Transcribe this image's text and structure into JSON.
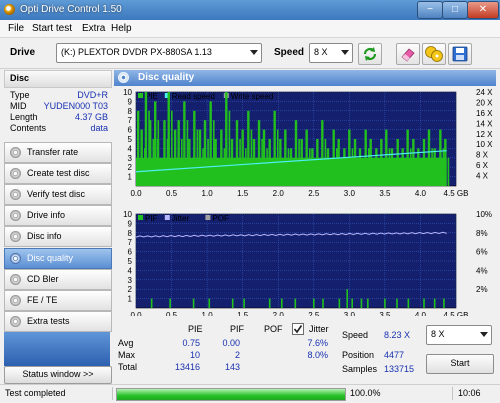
{
  "app": {
    "title": "Opti Drive Control 1.50"
  },
  "window_buttons": {
    "minimize": "−",
    "maximize": "□",
    "close": "✕"
  },
  "menu": [
    "File",
    "Start test",
    "Extra",
    "Help"
  ],
  "toolbar": {
    "drive_label": "Drive",
    "drive_value": "(K:)  PLEXTOR DVDR   PX-880SA 1.13",
    "speed_label": "Speed",
    "speed_value": "8 X",
    "icons": [
      "refresh-icon",
      "eraser-icon",
      "copy-disc-icon",
      "save-icon"
    ]
  },
  "disc": {
    "header": "Disc",
    "rows": [
      {
        "key": "Type",
        "value": "DVD+R"
      },
      {
        "key": "MID",
        "value": "YUDEN000 T03"
      },
      {
        "key": "Length",
        "value": "4.37 GB"
      },
      {
        "key": "Contents",
        "value": "data"
      }
    ]
  },
  "nav": [
    {
      "label": "Transfer rate",
      "active": false
    },
    {
      "label": "Create test disc",
      "active": false
    },
    {
      "label": "Verify test disc",
      "active": false
    },
    {
      "label": "Drive info",
      "active": false
    },
    {
      "label": "Disc info",
      "active": false
    },
    {
      "label": "Disc quality",
      "active": true
    },
    {
      "label": "CD Bler",
      "active": false
    },
    {
      "label": "FE / TE",
      "active": false
    },
    {
      "label": "Extra tests",
      "active": false
    }
  ],
  "status_window_button": "Status window >>",
  "panel": {
    "title": "Disc quality"
  },
  "colors": {
    "plot_bg": "#14206e",
    "grid": "#3a60c8",
    "pie": "#22c01e",
    "pif": "#22c01e",
    "read_speed": "#4cf0f0",
    "jitter": "#b8b8ff",
    "accent": "#4f83cc"
  },
  "chart_data": [
    {
      "type": "bar",
      "legend": [
        "PIE",
        "Read speed",
        "Write speed"
      ],
      "x_ticks": [
        "0.0",
        "0.5",
        "1.0",
        "1.5",
        "2.0",
        "2.5",
        "3.0",
        "3.5",
        "4.0",
        "4.5 GB"
      ],
      "y_left_ticks": [
        "1",
        "2",
        "3",
        "4",
        "5",
        "6",
        "7",
        "8",
        "9",
        "10"
      ],
      "y_right_ticks": [
        "4 X",
        "6 X",
        "8 X",
        "10 X",
        "12 X",
        "14 X",
        "16 X",
        "20 X",
        "24 X"
      ],
      "xlim": [
        0,
        4.5
      ],
      "ylim": [
        0,
        10
      ],
      "y2lim": [
        0,
        24
      ],
      "grid": true,
      "pie_bar_peaks": [
        [
          0.03,
          8
        ],
        [
          0.08,
          6
        ],
        [
          0.14,
          10
        ],
        [
          0.2,
          7
        ],
        [
          0.27,
          9
        ],
        [
          0.31,
          5
        ],
        [
          0.4,
          7
        ],
        [
          0.46,
          10
        ],
        [
          0.55,
          6
        ],
        [
          0.6,
          7
        ],
        [
          0.68,
          9
        ],
        [
          0.75,
          5
        ],
        [
          0.82,
          8
        ],
        [
          0.9,
          6
        ],
        [
          0.97,
          7
        ],
        [
          1.05,
          9
        ],
        [
          1.12,
          5
        ],
        [
          1.2,
          6
        ],
        [
          1.27,
          10
        ],
        [
          1.35,
          5
        ],
        [
          1.42,
          7
        ],
        [
          1.5,
          6
        ],
        [
          1.58,
          8
        ],
        [
          1.66,
          5
        ],
        [
          1.73,
          7
        ],
        [
          1.8,
          6
        ],
        [
          1.88,
          5
        ],
        [
          1.95,
          8
        ],
        [
          2.03,
          5
        ],
        [
          2.1,
          6
        ],
        [
          2.18,
          4
        ],
        [
          2.25,
          7
        ],
        [
          2.33,
          5
        ],
        [
          2.4,
          6
        ],
        [
          2.48,
          4
        ],
        [
          2.55,
          5
        ],
        [
          2.62,
          7
        ],
        [
          2.7,
          4
        ],
        [
          2.78,
          6
        ],
        [
          2.85,
          5
        ],
        [
          2.93,
          4
        ],
        [
          3.0,
          6
        ],
        [
          3.08,
          5
        ],
        [
          3.15,
          4
        ],
        [
          3.23,
          6
        ],
        [
          3.3,
          5
        ],
        [
          3.38,
          4
        ],
        [
          3.45,
          5
        ],
        [
          3.52,
          6
        ],
        [
          3.6,
          4
        ],
        [
          3.68,
          5
        ],
        [
          3.75,
          4
        ],
        [
          3.82,
          6
        ],
        [
          3.9,
          5
        ],
        [
          3.97,
          4
        ],
        [
          4.05,
          5
        ],
        [
          4.12,
          6
        ],
        [
          4.2,
          4
        ],
        [
          4.28,
          6
        ],
        [
          4.35,
          5
        ]
      ],
      "pie_baseline": 3,
      "read_speed": {
        "x": [
          0.0,
          4.37
        ],
        "y": [
          3.3,
          8.2
        ]
      }
    },
    {
      "type": "bar",
      "legend": [
        "PIF",
        "Jitter",
        "POF"
      ],
      "x_ticks": [
        "0.0",
        "0.5",
        "1.0",
        "1.5",
        "2.0",
        "2.5",
        "3.0",
        "3.5",
        "4.0",
        "4.5 GB"
      ],
      "y_left_ticks": [
        "1",
        "2",
        "3",
        "4",
        "5",
        "6",
        "7",
        "8",
        "9",
        "10"
      ],
      "y_right_ticks": [
        "2%",
        "4%",
        "6%",
        "8%",
        "10%"
      ],
      "xlim": [
        0,
        4.5
      ],
      "ylim": [
        0,
        10
      ],
      "y2lim": [
        0,
        10
      ],
      "grid": true,
      "pif_spikes": [
        [
          0.22,
          1
        ],
        [
          0.48,
          1
        ],
        [
          0.81,
          1
        ],
        [
          1.03,
          1
        ],
        [
          1.36,
          1
        ],
        [
          1.52,
          1
        ],
        [
          1.88,
          1
        ],
        [
          2.05,
          1
        ],
        [
          2.24,
          1
        ],
        [
          2.5,
          1
        ],
        [
          2.63,
          1
        ],
        [
          2.86,
          1
        ],
        [
          2.97,
          2
        ],
        [
          3.04,
          1
        ],
        [
          3.17,
          1
        ],
        [
          3.26,
          1
        ],
        [
          3.5,
          1
        ],
        [
          3.67,
          1
        ],
        [
          3.83,
          1
        ],
        [
          4.05,
          1
        ],
        [
          4.2,
          1
        ],
        [
          4.33,
          1
        ]
      ],
      "jitter": {
        "x": [
          0.0,
          4.37
        ],
        "y": [
          7.6,
          8.0
        ]
      }
    }
  ],
  "stats": {
    "headers": [
      "PIE",
      "PIF",
      "POF",
      "Jitter"
    ],
    "rows": [
      {
        "label": "Avg",
        "pie": "0.75",
        "pif": "0.00",
        "pof": "",
        "jitter": "7.6%"
      },
      {
        "label": "Max",
        "pie": "10",
        "pif": "2",
        "pof": "",
        "jitter": "8.0%"
      },
      {
        "label": "Total",
        "pie": "13416",
        "pif": "143",
        "pof": "",
        "jitter": ""
      }
    ],
    "speed_label": "Speed",
    "speed_value": "8.23 X",
    "speed_select": "8 X",
    "position_label": "Position",
    "position_value": "4477",
    "samples_label": "Samples",
    "samples_value": "133715",
    "start_button": "Start",
    "jitter_checked": true
  },
  "statusbar": {
    "text": "Test completed",
    "progress": 1.0,
    "percent": "100.0%",
    "time": "10:06"
  }
}
